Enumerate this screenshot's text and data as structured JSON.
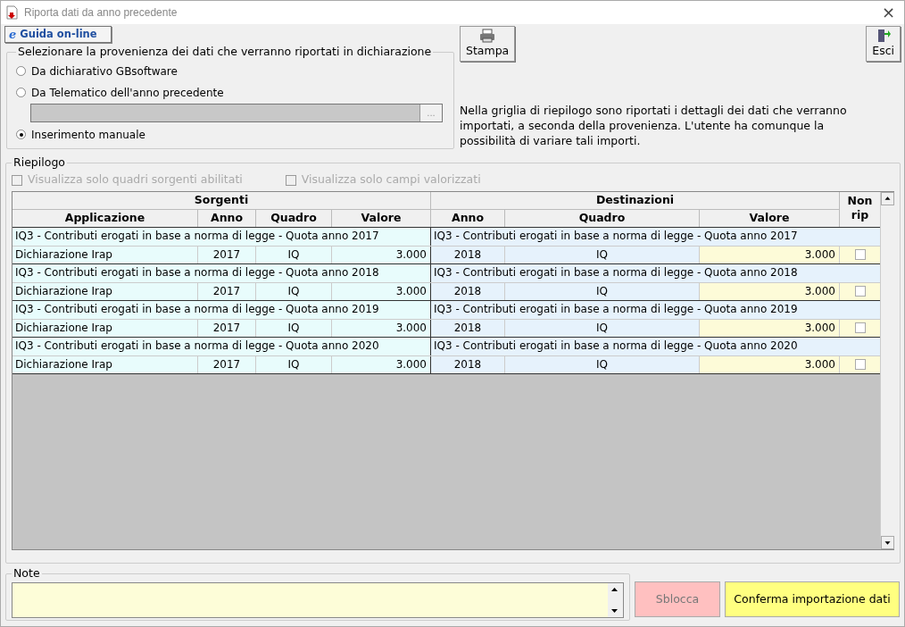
{
  "window": {
    "title": "Riporta dati da anno precedente",
    "close": "×"
  },
  "help_button": {
    "icon": "e",
    "label": "Guida on-line"
  },
  "source_group": {
    "title": "Selezionare la provenienza dei dati che verranno riportati in dichiarazione",
    "options": [
      {
        "label": "Da dichiarativo GBsoftware",
        "selected": false
      },
      {
        "label": "Da Telematico dell'anno precedente",
        "selected": false
      },
      {
        "label": "Inserimento manuale",
        "selected": true
      }
    ],
    "file_field": {
      "browse": "...",
      "disabled": true
    }
  },
  "toolbar": [
    {
      "kind": "print",
      "label": "Stampa"
    },
    {
      "kind": "exit",
      "label": "Esci"
    }
  ],
  "info_text": "Nella griglia di riepilogo sono riportati i dettagli dei dati che verranno importati, a seconda della provenienza. L'utente ha comunque la possibilità di variare tali importi.",
  "summary": {
    "title": "Riepilogo",
    "filters": [
      {
        "label": "Visualizza solo quadri sorgenti abilitati",
        "checked": false,
        "disabled": true
      },
      {
        "label": "Visualizza solo campi valorizzati",
        "checked": false,
        "disabled": true
      }
    ],
    "groups": [
      "Sorgenti",
      "Destinazioni"
    ],
    "columns": [
      "Applicazione",
      "Anno",
      "Quadro",
      "Valore",
      "Anno",
      "Quadro",
      "Valore",
      "Non rip"
    ],
    "rows": [
      {
        "source_title": "IQ3 - Contributi erogati in base a norma di legge - Quota anno 2017",
        "application": "Dichiarazione Irap",
        "source_year": "2017",
        "source_section": "IQ",
        "source_value": "3.000",
        "dest_title": "IQ3 - Contributi erogati in base a norma di legge - Quota anno 2017",
        "dest_year": "2018",
        "dest_section": "IQ",
        "dest_value": "3.000",
        "not_carried": false
      },
      {
        "source_title": "IQ3 - Contributi erogati in base a norma di legge - Quota anno 2018",
        "application": "Dichiarazione Irap",
        "source_year": "2017",
        "source_section": "IQ",
        "source_value": "3.000",
        "dest_title": "IQ3 - Contributi erogati in base a norma di legge - Quota anno 2018",
        "dest_year": "2018",
        "dest_section": "IQ",
        "dest_value": "3.000",
        "not_carried": false
      },
      {
        "source_title": "IQ3 - Contributi erogati in base a norma di legge - Quota anno 2019",
        "application": "Dichiarazione Irap",
        "source_year": "2017",
        "source_section": "IQ",
        "source_value": "3.000",
        "dest_title": "IQ3 - Contributi erogati in base a norma di legge - Quota anno 2019",
        "dest_year": "2018",
        "dest_section": "IQ",
        "dest_value": "3.000",
        "not_carried": false
      },
      {
        "source_title": "IQ3 - Contributi erogati in base a norma di legge - Quota anno 2020",
        "application": "Dichiarazione Irap",
        "source_year": "2017",
        "source_section": "IQ",
        "source_value": "3.000",
        "dest_title": "IQ3 - Contributi erogati in base a norma di legge - Quota anno 2020",
        "dest_year": "2018",
        "dest_section": "IQ",
        "dest_value": "3.000",
        "not_carried": false
      }
    ]
  },
  "note": {
    "title": "Note"
  },
  "actions": [
    {
      "kind": "unlock",
      "label": "Sblocca"
    },
    {
      "kind": "confirm",
      "label": "Conferma importazione dati"
    }
  ]
}
